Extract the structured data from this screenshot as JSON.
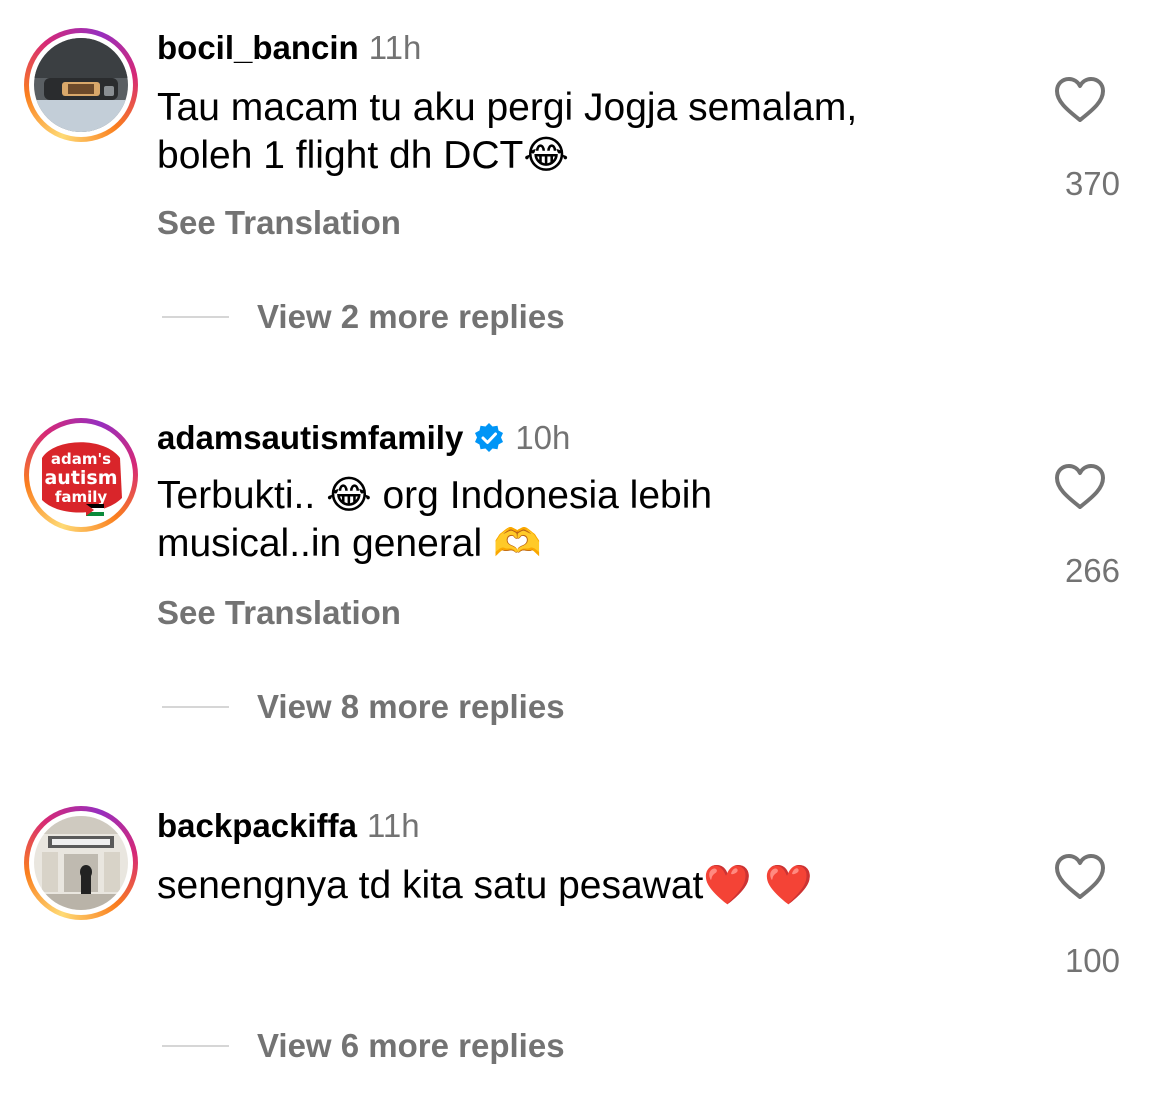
{
  "comments": [
    {
      "username": "bocil_bancin",
      "time": "11h",
      "verified": false,
      "text_lines": [
        "Tau macam tu aku pergi Jogja semalam,",
        "boleh 1 flight dh DCT"
      ],
      "emoji_after": "😂",
      "see_translation": "See Translation",
      "likes": "370",
      "replies": "View 2 more replies",
      "avatar": "car-interior-photo"
    },
    {
      "username": "adamsautismfamily",
      "time": "10h",
      "verified": true,
      "text_line1_before": "Terbukti.. ",
      "text_line1_emoji": "😂",
      "text_line1_after": " org Indonesia lebih",
      "text_line2": "musical..in general ",
      "text_line2_emoji": "🫶",
      "see_translation": "See Translation",
      "likes": "266",
      "replies": "View 8 more replies",
      "avatar": "adams-autism-family-logo",
      "avatar_logo_lines": [
        "adam's",
        "autism",
        "family"
      ]
    },
    {
      "username": "backpackiffa",
      "time": "11h",
      "verified": false,
      "text": "senengnya td kita satu pesawat",
      "emoji_after": "❤️ ❤️",
      "likes": "100",
      "replies": "View 6 more replies",
      "avatar": "building-photo"
    }
  ],
  "colors": {
    "secondary_text": "#737373",
    "verified_blue": "#0095f6",
    "heart_outline": "#737373",
    "divider": "#d6d6d6"
  },
  "icons": [
    "heart-outline-icon",
    "verified-badge-icon"
  ]
}
